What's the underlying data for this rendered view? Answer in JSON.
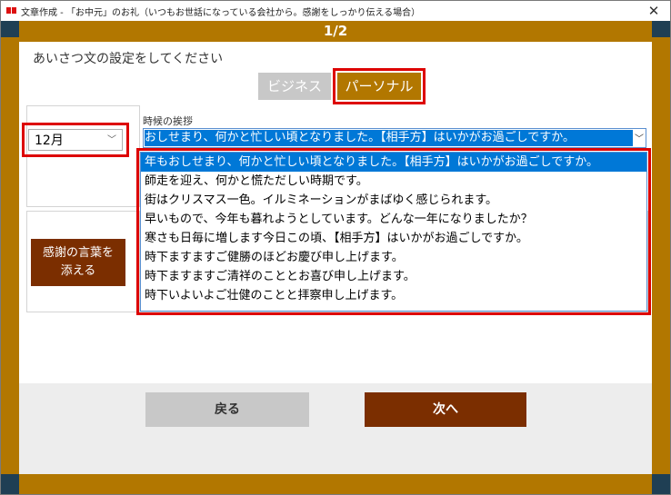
{
  "window": {
    "title": "文章作成 - 「お中元」のお礼（いつもお世話になっている会社から。感謝をしっかり伝える場合）",
    "close_symbol": "✕"
  },
  "page_indicator": "1/2",
  "instruction": "あいさつ文の設定をしてください",
  "tabs": {
    "business": "ビジネス",
    "personal": "パーソナル"
  },
  "month_select": {
    "value": "12月"
  },
  "greeting": {
    "label": "時候の挨拶",
    "selected": "おしせまり、何かと忙しい頃となりました。【相手方】はいかがお過ごしですか。",
    "options": [
      "年もおしせまり、何かと忙しい頃となりました。【相手方】はいかがお過ごしですか。",
      "師走を迎え、何かと慌ただしい時期です。",
      "街はクリスマス一色。イルミネーションがまばゆく感じられます。",
      "早いもので、今年も暮れようとしています。どんな一年になりましたか？",
      "寒さも日毎に増します今日この頃、【相手方】はいかがお過ごしですか。",
      "時下ますますご健勝のほどお慶び申し上げます。",
      "時下ますますご清祥のこととお喜び申し上げます。",
      "時下いよいよご壮健のことと拝察申し上げます。"
    ]
  },
  "thanks_button": {
    "line1": "感謝の言葉を",
    "line2": "添える"
  },
  "footer": {
    "back": "戻る",
    "next": "次へ"
  },
  "colors": {
    "accent_brown": "#b27700",
    "dark_brown": "#7b2e00",
    "highlight_red": "#dd0000",
    "selection_blue": "#0078d7"
  }
}
